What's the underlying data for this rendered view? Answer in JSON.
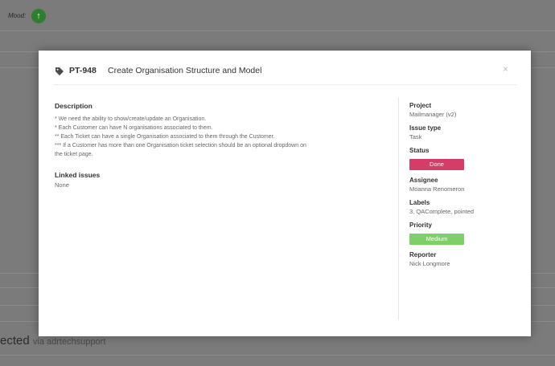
{
  "background": {
    "mood_label": "Mood:",
    "status_text": "ected",
    "status_via": "via adrtechsupport"
  },
  "modal": {
    "issue_key": "PT-948",
    "title": "Create Organisation Structure and Model",
    "close_label": "×",
    "description": {
      "heading": "Description",
      "lines": [
        "* We need the ability to show/create/update an Organisation.",
        "* Each Customer can have N organisations associated to them.",
        "** Each Ticket can have a single Organisation associated to them through the Customer.",
        "*** If a Customer has more than one Organisation ticket selection should be an optional dropdown on",
        "the ticket page."
      ]
    },
    "linked_issues": {
      "heading": "Linked issues",
      "value": "None"
    },
    "sidebar": {
      "project_label": "Project",
      "project_value": "Mailmanager (v2)",
      "issue_type_label": "Issue type",
      "issue_type_value": "Task",
      "status_label": "Status",
      "status_value": "Done",
      "assignee_label": "Assignee",
      "assignee_value": "Moanna Renomeron",
      "labels_label": "Labels",
      "labels_value": "3, QAComplete, pointed",
      "priority_label": "Priority",
      "priority_value": "Medium",
      "reporter_label": "Reporter",
      "reporter_value": "Nick Longmore"
    }
  },
  "colors": {
    "status_done": "#d43d68",
    "priority_medium": "#7fcf69",
    "overlay": "#7b7b7b"
  },
  "icons": {
    "issue": "tag-icon",
    "mood": "arrow-up-icon"
  }
}
